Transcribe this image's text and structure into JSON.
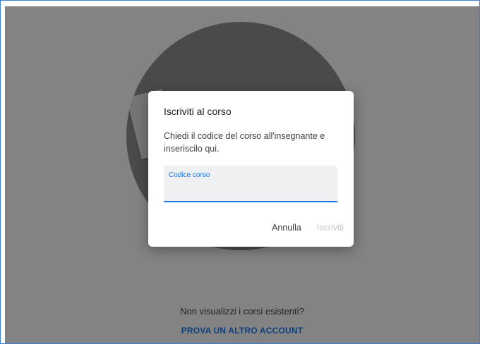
{
  "background": {
    "empty_state_text": "Non visualizzi i corsi esistenti?",
    "switch_account_link": "PROVA UN ALTRO ACCOUNT"
  },
  "dialog": {
    "title": "Iscriviti al corso",
    "description": "Chiedi il codice del corso all'insegnante e inseriscilo qui.",
    "field": {
      "label": "Codice corso",
      "value": ""
    },
    "buttons": {
      "cancel": "Annulla",
      "join": "Iscriviti"
    }
  },
  "colors": {
    "accent": "#1a73e8",
    "disabled": "#c4c7ca",
    "scrim": "rgba(0,0,0,0.46)"
  }
}
